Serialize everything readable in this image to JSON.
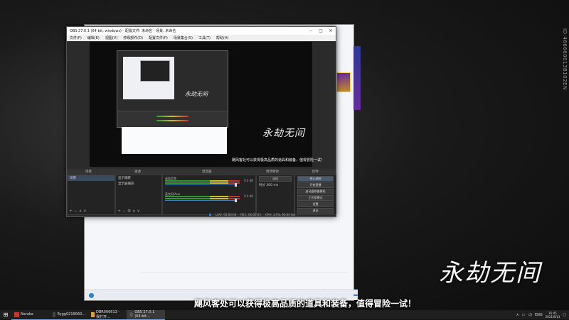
{
  "desktop": {
    "vertical_id": "ID:466660013B102EN",
    "logo": "永劫无间",
    "subtitle": "飓风客处可以获得极高品质的道具和装备，值得冒险一试！"
  },
  "background_window": {
    "input_placeholder": "",
    "bottom_items": [
      "",
      "",
      "",
      "",
      "",
      "",
      "",
      ""
    ],
    "right_tag": ""
  },
  "right_panel": {
    "header": "",
    "rows": [
      [
        "",
        "",
        ""
      ],
      [
        "",
        "",
        ""
      ]
    ]
  },
  "obs": {
    "title": "OBS 27.0.1 (64-bit, windows) - 配置文件: 未命名 - 场景: 未命名",
    "menu": [
      "文件(F)",
      "编辑(E)",
      "视图(V)",
      "停靠部件(D)",
      "配置文件(P)",
      "场景集合(S)",
      "工具(T)",
      "帮助(H)"
    ],
    "preview": {
      "logo": "永劫无间",
      "subtitle": "飓风客处可以获得极高品质的道具和装备，值得冒险一试！"
    },
    "dock_titles": {
      "scenes": "场景",
      "sources": "来源",
      "mixer": "混音器",
      "transitions": "转场特效",
      "controls": "控件"
    },
    "scenes": [
      "场景"
    ],
    "sources": [
      "显示捕获",
      "显示器捕获"
    ],
    "mixer": [
      {
        "name": "桌面音频",
        "vol": "0.0 dB"
      },
      {
        "name": "麦克风/Aux",
        "vol": "0.0 dB"
      }
    ],
    "transitions": {
      "type": "淡出",
      "duration_label": "时长",
      "duration": "300 ms"
    },
    "controls": [
      "停止录制",
      "开始直播",
      "启动虚拟摄像机",
      "工作室模式",
      "设置",
      "退出"
    ],
    "status": {
      "live": "LIVE: 00:00:00",
      "rec": "REC: 00:00:25",
      "cpu": "CPU: 3.5%, 60.00 fps"
    }
  },
  "taskbar": {
    "apps": [
      {
        "label": "Naraka",
        "color": "#c0392b"
      },
      {
        "label": "Rygg0219060...",
        "color": "#444444"
      },
      {
        "label": "DBR006613 - 我打开...",
        "color": "#e0a030"
      },
      {
        "label": "OBS 27.0.1 (64-bit...",
        "color": "#555555"
      }
    ],
    "tray": {
      "lang": "ENG",
      "time": "16:45",
      "date": "2021/8/13"
    }
  },
  "colors": {
    "accent": "#2a7de1",
    "obs_bg": "#2b2b2b"
  }
}
